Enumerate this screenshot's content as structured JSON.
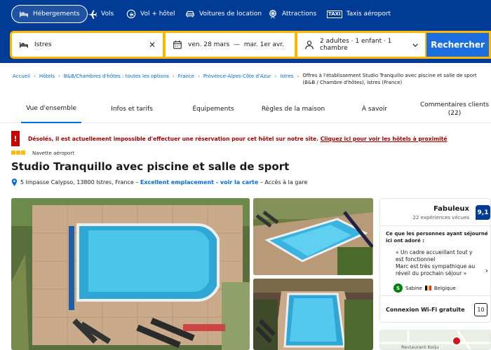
{
  "nav": {
    "items": [
      {
        "label": "Hébergements",
        "icon": "bed-icon",
        "active": true
      },
      {
        "label": "Vols",
        "icon": "plane-icon",
        "active": false
      },
      {
        "label": "Vol + hôtel",
        "icon": "plane-hotel-icon",
        "active": false
      },
      {
        "label": "Voitures de location",
        "icon": "car-icon",
        "active": false
      },
      {
        "label": "Attractions",
        "icon": "attractions-icon",
        "active": false
      },
      {
        "label": "Taxis aéroport",
        "icon": "taxi-icon",
        "active": false
      }
    ],
    "taxi_glyph": "TAXI"
  },
  "search": {
    "destination": "Istres",
    "dates": "ven. 28 mars  —  mar. 1er avr.",
    "guests": "2 adultes · 1 enfant · 1 chambre",
    "button": "Rechercher",
    "clear": "✕"
  },
  "breadcrumb": {
    "items": [
      "Accueil",
      "Hôtels",
      "B&B/Chambres d'hôtes : toutes les options",
      "France",
      "Provence-Alpes-Côte d'Azur",
      "Istres"
    ],
    "current": "Offres à l'établissement Studio Tranquillo avec piscine et salle de sport (B&B / Chambre d'hôtes), Istres (France)",
    "separator": "›"
  },
  "tabs": [
    {
      "label": "Vue d'ensemble",
      "active": true
    },
    {
      "label": "Infos et tarifs",
      "active": false
    },
    {
      "label": "Équipements",
      "active": false
    },
    {
      "label": "Règles de la maison",
      "active": false
    },
    {
      "label": "À savoir",
      "active": false
    },
    {
      "label": "Commentaires clients (22)",
      "active": false
    }
  ],
  "alert": {
    "badge": "!",
    "text": "Désolés, il est actuellement impossible d'effectuer une réservation pour cet hôtel sur notre site.",
    "link": "Cliquez ici pour voir les hôtels à proximité"
  },
  "hotel": {
    "stars": 3,
    "badge": "Navette aéroport",
    "title": "Studio Tranquillo avec piscine et salle de sport",
    "address": "5 Impasse Calypso, 13800 Istres, France –",
    "location_link": "Excellent emplacement - voir la carte",
    "address_suffix": "– Accès à la gare"
  },
  "review": {
    "word": "Fabuleux",
    "count": "22 expériences vécues",
    "score": "9,1",
    "heading": "Ce que les personnes ayant séjourné ici ont adoré :",
    "quote": "« Un cadre accueillant tout y est fonctionnel\nMarc est très sympathique au réveil du prochain séjour »",
    "arrow": "›",
    "author": "Sabine",
    "author_initial": "S",
    "country": "Belgique",
    "wifi_label": "Connexion Wi-Fi gratuite",
    "wifi_score": "10"
  },
  "map": {
    "label": "Restaurant Koiju"
  },
  "colors": {
    "brand": "#003b95",
    "accent": "#006ce4",
    "search_border": "#ffb700",
    "alert": "#a30000",
    "star": "#febb02"
  }
}
